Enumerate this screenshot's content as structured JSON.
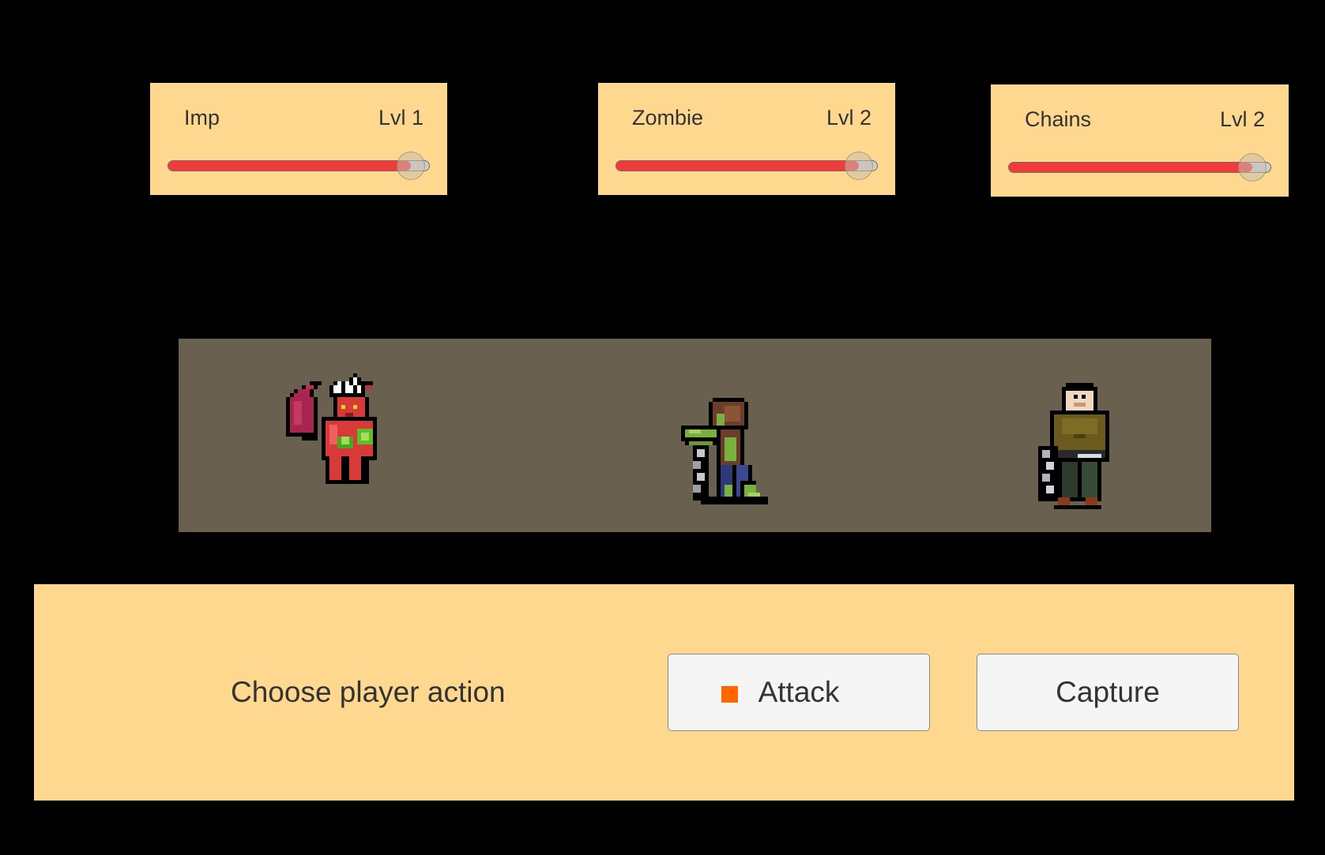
{
  "party": [
    {
      "name": "Imp",
      "level": "Lvl 1",
      "hp_fraction": 0.93
    },
    {
      "name": "Zombie",
      "level": "Lvl 2",
      "hp_fraction": 0.93
    },
    {
      "name": "Chains",
      "level": "Lvl 2",
      "hp_fraction": 0.93
    }
  ],
  "colors": {
    "card_bg": "#ffd890",
    "hp_fill": "#ef3b3b",
    "arena_bg": "#696050",
    "selection_marker": "#ff6600"
  },
  "sprites": [
    "imp-sprite",
    "zombie-sprite",
    "chains-sprite"
  ],
  "action_panel": {
    "prompt": "Choose player action",
    "buttons": {
      "attack": "Attack",
      "capture": "Capture"
    },
    "selected": "attack"
  }
}
